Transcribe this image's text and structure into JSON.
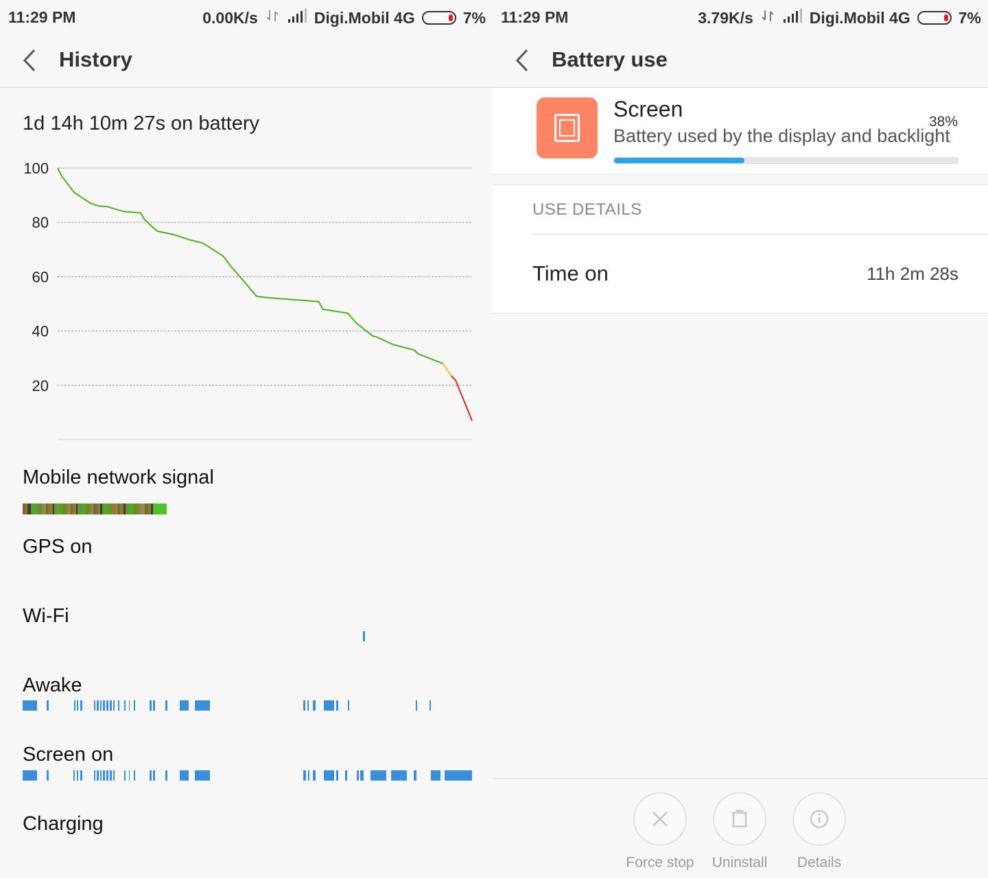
{
  "left": {
    "status": {
      "time": "11:29 PM",
      "speed": "0.00K/s",
      "carrier": "Digi.Mobil 4G",
      "battery": "7%"
    },
    "appbar": {
      "title": "History"
    },
    "summary": "1d 14h 10m 27s on battery",
    "sections": {
      "mobile_network_signal": "Mobile network signal",
      "gps": "GPS on",
      "wifi": "Wi-Fi",
      "awake": "Awake",
      "screen_on": "Screen on",
      "charging": "Charging"
    },
    "colors": {
      "high": "#4caf1a",
      "medium": "#f0c419",
      "low": "#e02020",
      "activity": "#3a8fd8"
    }
  },
  "chart_data": {
    "type": "line",
    "title": "",
    "xlabel": "",
    "ylabel": "",
    "ylim": [
      0,
      100
    ],
    "y_ticks": [
      "100",
      "80",
      "60",
      "40",
      "20"
    ],
    "x": [
      0,
      1,
      2,
      3,
      4,
      5,
      6,
      7,
      8,
      10,
      12,
      13,
      16,
      20,
      21,
      24,
      28,
      32,
      35,
      38,
      40,
      42,
      44,
      48,
      50,
      53,
      60,
      63,
      64,
      70,
      72,
      76,
      77,
      81,
      86,
      87,
      93,
      95,
      96,
      100
    ],
    "series": [
      {
        "values": [
          100,
          97,
          95,
          93,
          91,
          90,
          89,
          88,
          87,
          86,
          85.8,
          85.3,
          84,
          83.5,
          81,
          76.8,
          75.5,
          73.5,
          72.4,
          69.5,
          67.5,
          63.4,
          60,
          52.8,
          52.4,
          52,
          51.2,
          50.8,
          48,
          46.6,
          43,
          38.2,
          37.8,
          35,
          33,
          31.6,
          28,
          23.5,
          22,
          7
        ]
      }
    ],
    "color_segments": [
      {
        "from_x": 0,
        "to_x": 93,
        "level": "high"
      },
      {
        "from_x": 93,
        "to_x": 95,
        "level": "medium"
      },
      {
        "from_x": 95,
        "to_x": 100,
        "level": "low"
      }
    ],
    "grid": true
  },
  "right": {
    "status": {
      "time": "11:29 PM",
      "speed": "3.79K/s",
      "carrier": "Digi.Mobil 4G",
      "battery": "7%"
    },
    "appbar": {
      "title": "Battery use"
    },
    "item": {
      "icon": "screen-icon",
      "title": "Screen",
      "description": "Battery used by the display and backlight",
      "percent": "38%",
      "usage_fraction": 0.38
    },
    "details": {
      "header": "USE DETAILS",
      "time_label": "Time on",
      "time_value": "11h 2m 28s"
    },
    "buttons": [
      {
        "label": "Force stop",
        "icon": "close-icon"
      },
      {
        "label": "Uninstall",
        "icon": "trash-icon"
      },
      {
        "label": "Details",
        "icon": "info-icon"
      }
    ]
  }
}
